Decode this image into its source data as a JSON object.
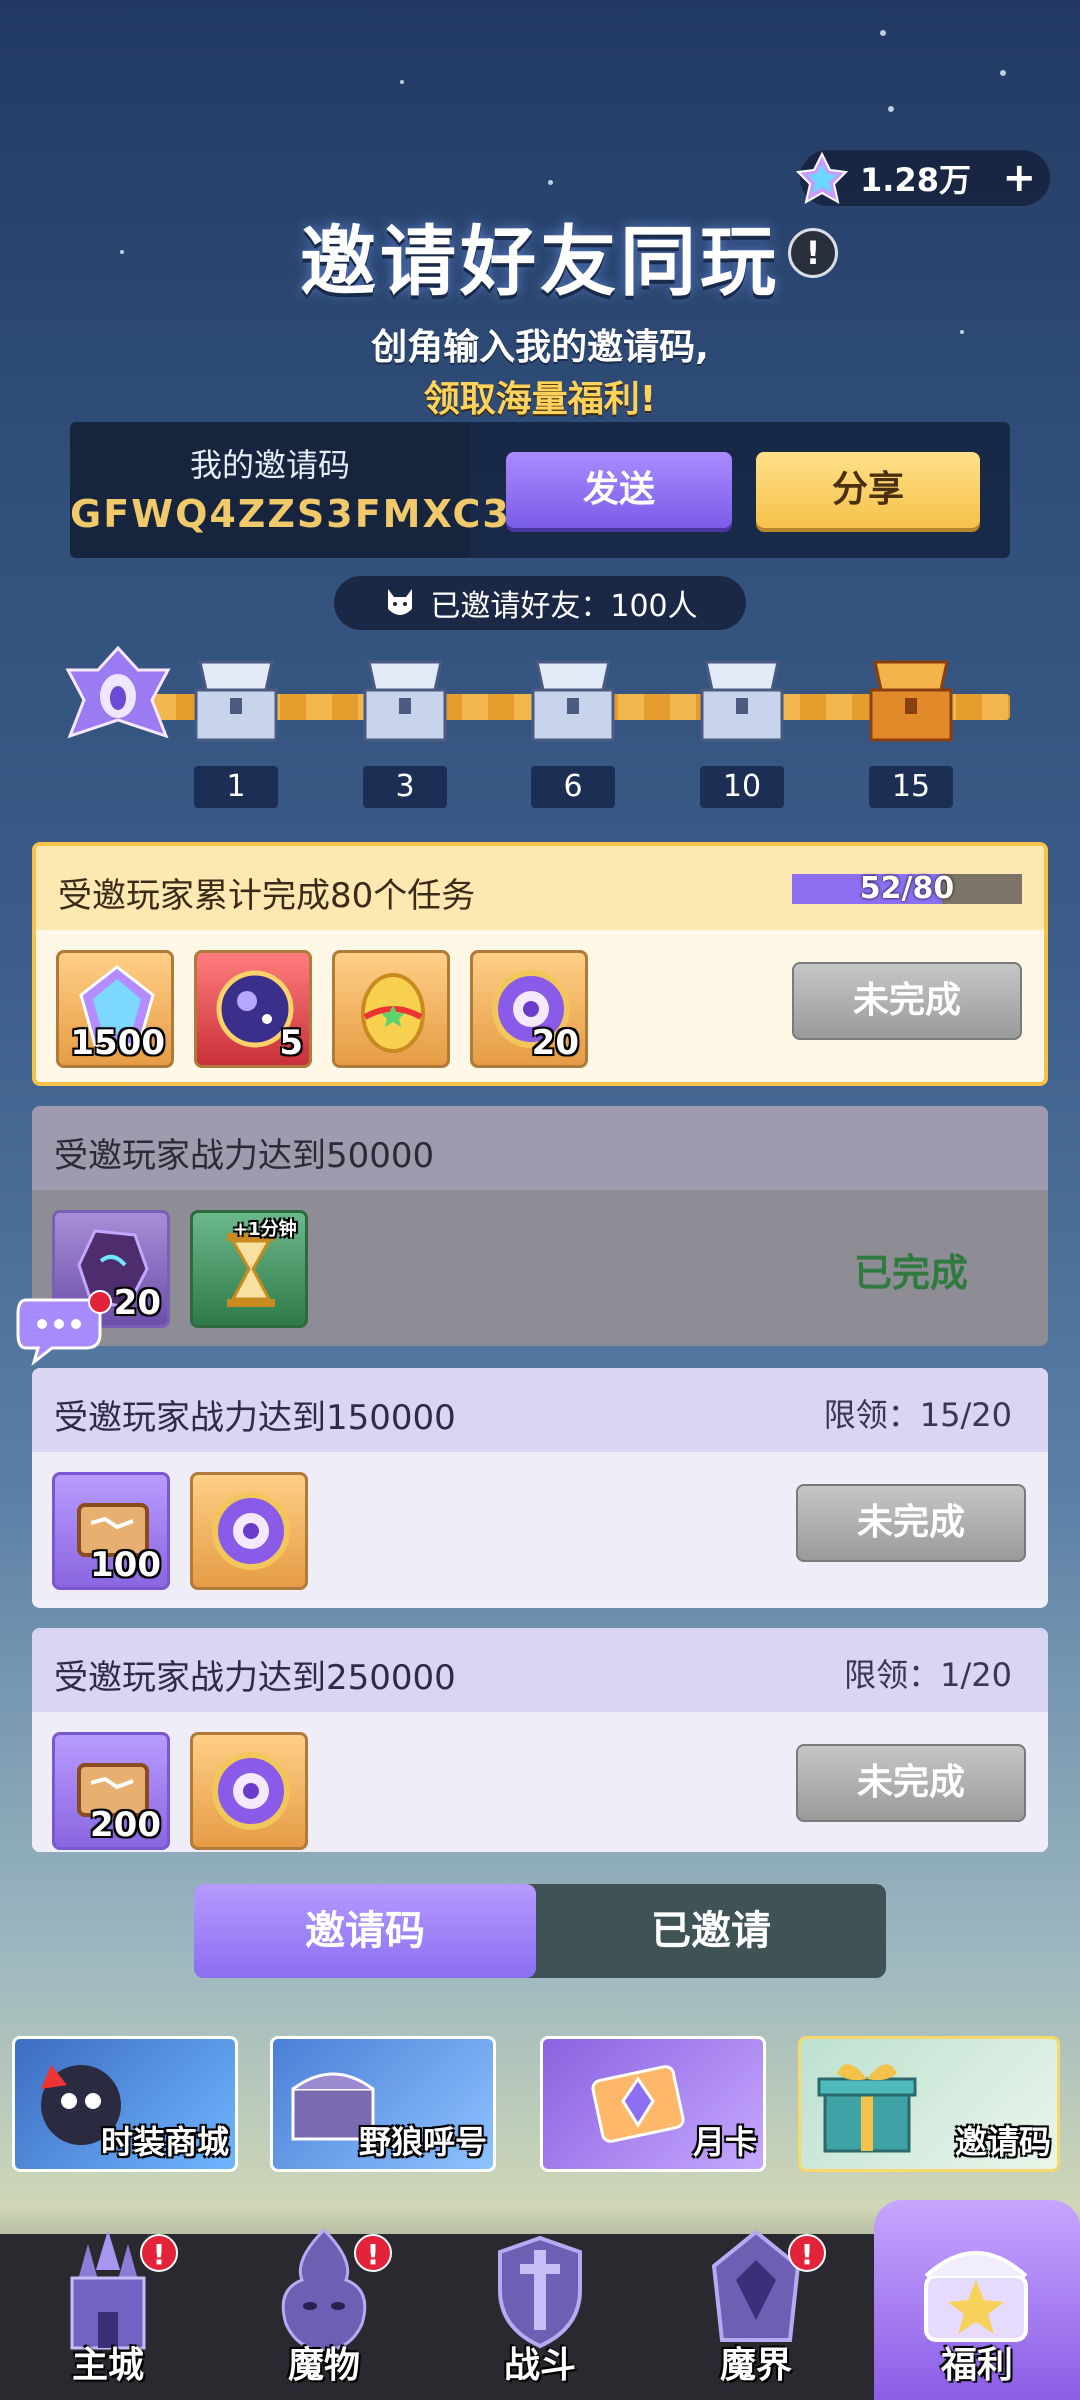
{
  "currency": {
    "amount": "1.28万",
    "plus": "+",
    "icon": "star-gem-icon"
  },
  "header": {
    "title": "邀请好友同玩",
    "info": "!",
    "subtitle_line1": "创角输入我的邀请码,",
    "subtitle_line2": "领取海量福利!"
  },
  "invite_code": {
    "label": "我的邀请码",
    "value": "GFWQ4ZZS3FMXC3"
  },
  "buttons": {
    "send": "发送",
    "share": "分享"
  },
  "invited": {
    "text": "已邀请好友：100人"
  },
  "milestones": [
    "1",
    "3",
    "6",
    "10",
    "15"
  ],
  "tasks": [
    {
      "title": "受邀玩家累计完成80个任务",
      "progress_text": "52/80",
      "progress": 0.65,
      "status": "未完成",
      "rewards": [
        {
          "icon": "crystal-gem-icon",
          "count": "1500"
        },
        {
          "icon": "cosmic-orb-icon",
          "count": "5"
        },
        {
          "icon": "golden-egg-icon",
          "count": ""
        },
        {
          "icon": "purple-emblem-icon",
          "count": "20"
        }
      ]
    },
    {
      "title": "受邀玩家战力达到50000",
      "status": "已完成",
      "rewards": [
        {
          "icon": "dark-crystal-icon",
          "count": "20"
        },
        {
          "icon": "hourglass-icon",
          "count": "",
          "tag": "+1分钟"
        }
      ]
    },
    {
      "title": "受邀玩家战力达到150000",
      "limit": "限领：15/20",
      "status": "未完成",
      "rewards": [
        {
          "icon": "scroll-icon",
          "count": "100"
        },
        {
          "icon": "purple-emblem-icon",
          "count": ""
        }
      ]
    },
    {
      "title": "受邀玩家战力达到250000",
      "limit": "限领：1/20",
      "status": "未完成",
      "rewards": [
        {
          "icon": "scroll-icon",
          "count": "200"
        },
        {
          "icon": "purple-emblem-icon",
          "count": ""
        }
      ]
    }
  ],
  "tabs": {
    "active": "邀请码",
    "inactive": "已邀请"
  },
  "banners": [
    "时装商城",
    "野狼呼号",
    "月卡",
    "邀请码"
  ],
  "nav": [
    "主城",
    "魔物",
    "战斗",
    "魔界",
    "福利"
  ]
}
